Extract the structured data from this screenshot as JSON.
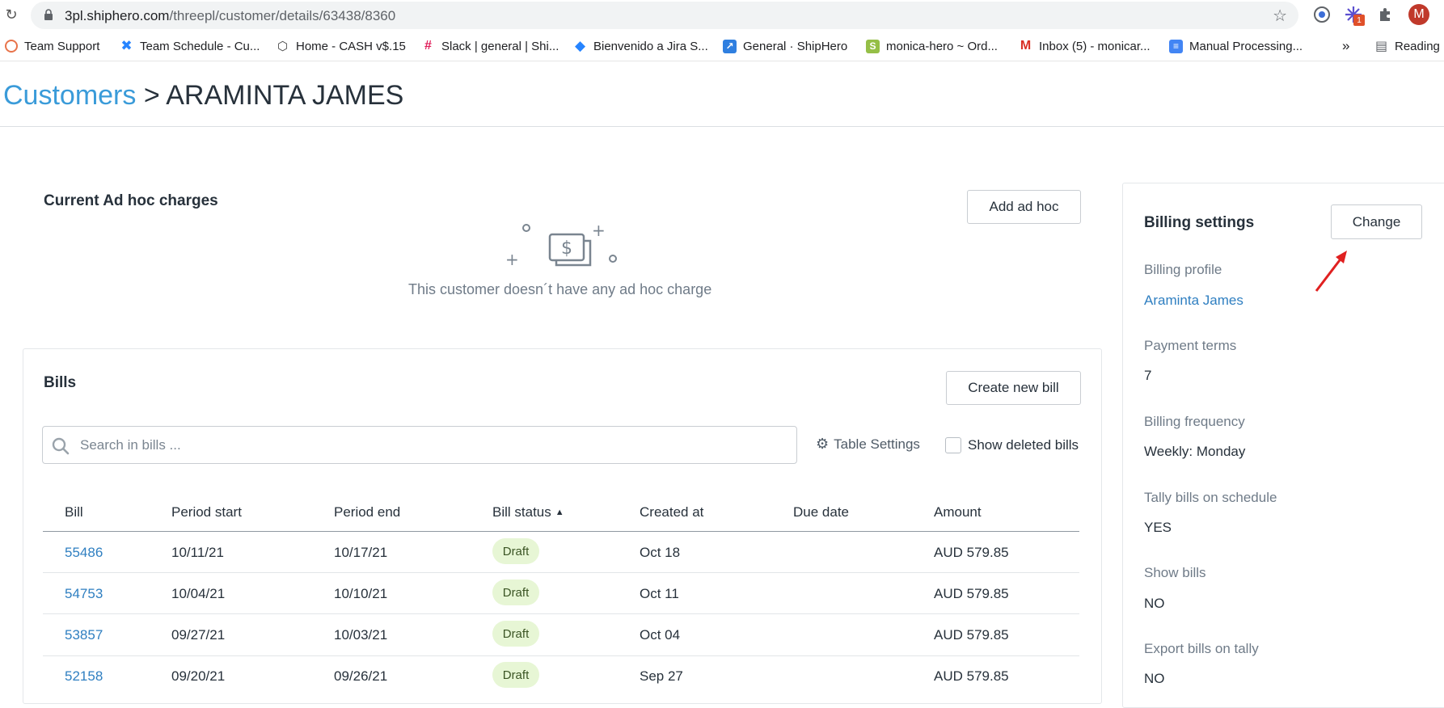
{
  "browser": {
    "url_host": "3pl.shiphero.com",
    "url_path": "/threepl/customer/details/63438/8360",
    "profile_initial": "M",
    "ext_badge": "1"
  },
  "bookmarks": [
    {
      "label": "Team Support"
    },
    {
      "label": "Team Schedule - Cu..."
    },
    {
      "label": "Home - CASH v$.15"
    },
    {
      "label": "Slack | general | Shi..."
    },
    {
      "label": "Bienvenido a Jira S..."
    },
    {
      "label": "General · ShipHero"
    },
    {
      "label": "monica-hero ~ Ord..."
    },
    {
      "label": "Inbox (5) - monicar..."
    },
    {
      "label": "Manual Processing..."
    }
  ],
  "bookmarks_overflow": "»",
  "reading_list": "Reading",
  "breadcrumb": {
    "parent": "Customers",
    "separator": " > ",
    "current": "ARAMINTA JAMES"
  },
  "adhoc": {
    "title": "Current Ad hoc charges",
    "add_label": "Add ad hoc",
    "empty_text": "This customer doesn´t have any ad hoc charge"
  },
  "bills": {
    "title": "Bills",
    "create_label": "Create new bill",
    "search_placeholder": "Search in bills ...",
    "table_settings": "Table Settings",
    "show_deleted": "Show deleted bills",
    "columns": [
      "Bill",
      "Period start",
      "Period end",
      "Bill status",
      "Created at",
      "Due date",
      "Amount"
    ],
    "rows": [
      {
        "bill": "55486",
        "start": "10/11/21",
        "end": "10/17/21",
        "status": "Draft",
        "created": "Oct 18",
        "due": "",
        "amount": "AUD 579.85"
      },
      {
        "bill": "54753",
        "start": "10/04/21",
        "end": "10/10/21",
        "status": "Draft",
        "created": "Oct 11",
        "due": "",
        "amount": "AUD 579.85"
      },
      {
        "bill": "53857",
        "start": "09/27/21",
        "end": "10/03/21",
        "status": "Draft",
        "created": "Oct 04",
        "due": "",
        "amount": "AUD 579.85"
      },
      {
        "bill": "52158",
        "start": "09/20/21",
        "end": "09/26/21",
        "status": "Draft",
        "created": "Sep 27",
        "due": "",
        "amount": "AUD 579.85"
      }
    ]
  },
  "billing": {
    "title": "Billing settings",
    "change_label": "Change",
    "fields": [
      {
        "label": "Billing profile",
        "value": "Araminta James"
      },
      {
        "label": "Payment terms",
        "value": "7"
      },
      {
        "label": "Billing frequency",
        "value": "Weekly: Monday"
      },
      {
        "label": "Tally bills on schedule",
        "value": "YES"
      },
      {
        "label": "Show bills",
        "value": "NO"
      },
      {
        "label": "Export bills on tally",
        "value": "NO"
      }
    ]
  },
  "colors": {
    "accent": "#3a9bd9",
    "link": "#2f7fc1",
    "badge_bg": "#e7f6d5",
    "annotation_arrow": "#e02020"
  }
}
